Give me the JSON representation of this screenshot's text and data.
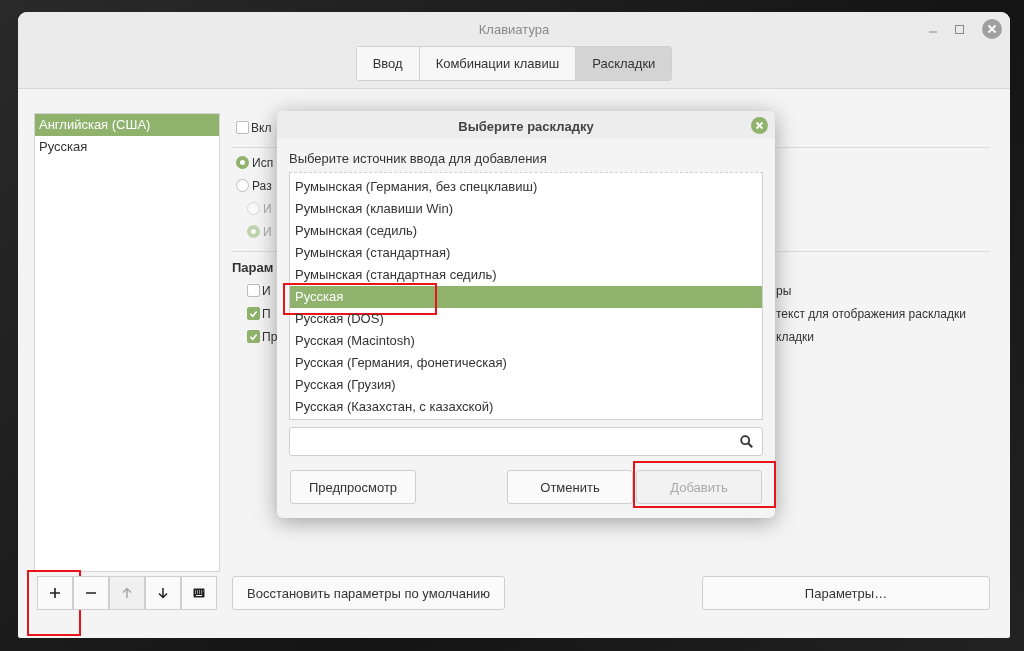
{
  "window": {
    "title": "Клавиатура"
  },
  "tabs": [
    {
      "label": "Ввод",
      "selected": false
    },
    {
      "label": "Комбинации клавиш",
      "selected": false
    },
    {
      "label": "Раскладки",
      "selected": true
    }
  ],
  "layouts": {
    "items": [
      {
        "label": "Английская (США)",
        "selected": true
      },
      {
        "label": "Русская",
        "selected": false
      }
    ],
    "toolbar": [
      {
        "kind": "add",
        "disabled": false,
        "highlighted": true
      },
      {
        "kind": "remove",
        "disabled": false,
        "highlighted": false
      },
      {
        "kind": "up",
        "disabled": true,
        "highlighted": false
      },
      {
        "kind": "down",
        "disabled": false,
        "highlighted": false
      },
      {
        "kind": "keyboard",
        "disabled": false,
        "highlighted": false
      }
    ]
  },
  "sections": [
    {
      "rows": [
        {
          "kind": "checkbox",
          "text": "Вкл",
          "checked": false
        }
      ]
    },
    {
      "rows": [
        {
          "kind": "radio",
          "text": "Исп",
          "selected": true
        },
        {
          "kind": "radio",
          "text": "Раз",
          "selected": false,
          "children": [
            {
              "kind": "radio",
              "text": "И",
              "selected": false,
              "disabled": true
            },
            {
              "kind": "radio",
              "text": "И",
              "selected": true,
              "disabled": true
            }
          ]
        }
      ]
    },
    {
      "heading": "Парам",
      "rows": [
        {
          "kind": "checkbox",
          "text": "И",
          "text_right": "ры",
          "checked": false
        },
        {
          "kind": "checkbox",
          "text": "П",
          "text_right": "текст для отображения раскладки",
          "checked": true
        },
        {
          "kind": "checkbox",
          "text": "Пр",
          "text_right": "кладки",
          "checked": true
        }
      ]
    }
  ],
  "restore_button": "Восстановить параметры по умолчанию",
  "settings_button": "Параметры…",
  "dialog": {
    "title": "Выберите раскладку",
    "prompt": "Выберите источник ввода для добавления",
    "items": [
      {
        "label": "Румынская (Германия, без спецклавиш)",
        "selected": false,
        "highlighted": false
      },
      {
        "label": "Румынская (клавиши Win)",
        "selected": false,
        "highlighted": false
      },
      {
        "label": "Румынская (седиль)",
        "selected": false,
        "highlighted": false
      },
      {
        "label": "Румынская (стандартная)",
        "selected": false,
        "highlighted": false
      },
      {
        "label": "Румынская (стандартная седиль)",
        "selected": false,
        "highlighted": false
      },
      {
        "label": "Русская",
        "selected": true,
        "highlighted": true
      },
      {
        "label": "Русская (DOS)",
        "selected": false,
        "highlighted": false
      },
      {
        "label": "Русская (Macintosh)",
        "selected": false,
        "highlighted": false
      },
      {
        "label": "Русская (Германия, фонетическая)",
        "selected": false,
        "highlighted": false
      },
      {
        "label": "Русская (Грузия)",
        "selected": false,
        "highlighted": false
      },
      {
        "label": "Русская (Казахстан, с казахской)",
        "selected": false,
        "highlighted": false
      }
    ],
    "buttons": [
      {
        "label": "Предпросмотр",
        "disabled": false,
        "highlighted": false
      },
      {
        "label": "Отменить",
        "disabled": false,
        "highlighted": false
      },
      {
        "label": "Добавить",
        "disabled": true,
        "highlighted": true
      }
    ]
  }
}
